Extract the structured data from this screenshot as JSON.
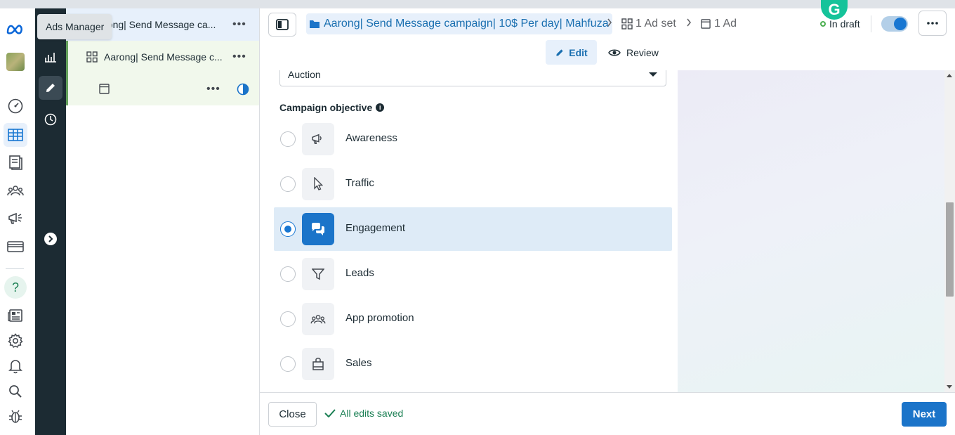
{
  "tooltip": {
    "text": "Ads Manager"
  },
  "tree": {
    "campaign_label": "Aarong| Send Message ca...",
    "adset_label": "Aarong| Send Message c...",
    "more": "•••"
  },
  "header": {
    "campaign_crumb": "Aarong| Send Message campaign| 10$ Per day| Mahfuza",
    "adset_crumb": "1 Ad set",
    "ad_crumb": "1 Ad",
    "status": "In draft",
    "grammarly": "G",
    "edit_label": "Edit",
    "review_label": "Review"
  },
  "form": {
    "buying_type_value": "Auction",
    "objective_title": "Campaign objective",
    "info_glyph": "i",
    "objectives": [
      {
        "label": "Awareness",
        "icon": "megaphone-icon",
        "selected": false
      },
      {
        "label": "Traffic",
        "icon": "cursor-icon",
        "selected": false
      },
      {
        "label": "Engagement",
        "icon": "chat-bubbles-icon",
        "selected": true
      },
      {
        "label": "Leads",
        "icon": "funnel-icon",
        "selected": false
      },
      {
        "label": "App promotion",
        "icon": "people-icon",
        "selected": false
      },
      {
        "label": "Sales",
        "icon": "shopping-bag-icon",
        "selected": false
      }
    ]
  },
  "footer": {
    "close_label": "Close",
    "saved_text": "All edits saved",
    "next_label": "Next"
  },
  "rail": {
    "help_glyph": "?"
  },
  "colors": {
    "accent": "#1877d2",
    "brand_dark": "#1c2b33",
    "success": "#1a7f53",
    "grammarly": "#15c39a"
  }
}
